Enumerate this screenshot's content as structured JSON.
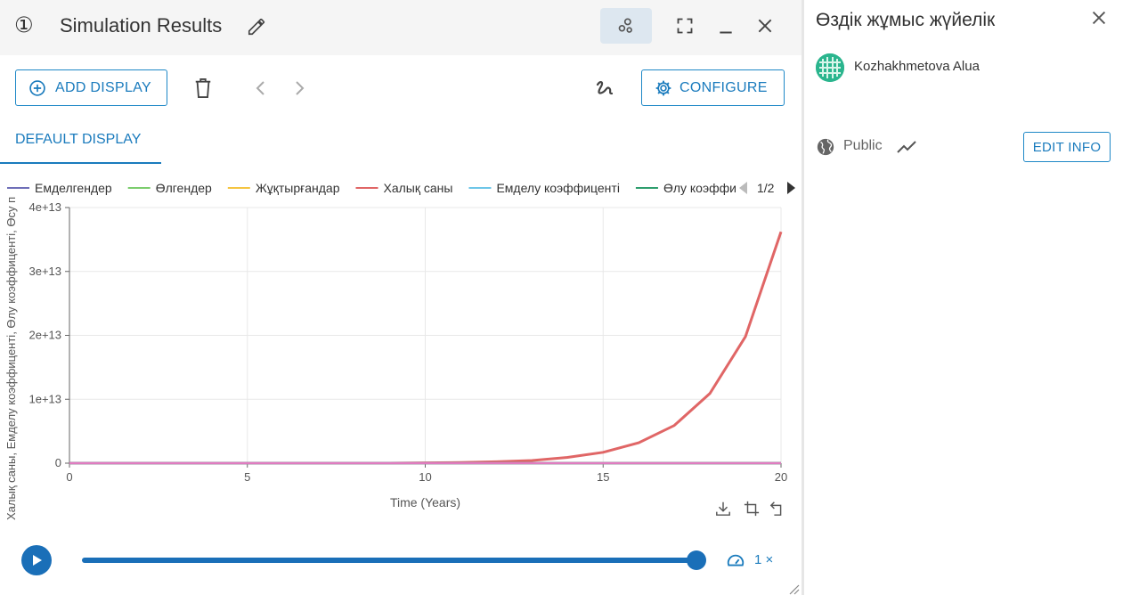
{
  "window": {
    "number": "①",
    "title": "Simulation Results"
  },
  "toolbar": {
    "add_display_label": "ADD DISPLAY",
    "configure_label": "CONFIGURE"
  },
  "tabs": [
    {
      "label": "DEFAULT DISPLAY",
      "active": true
    }
  ],
  "chart_data": {
    "type": "line",
    "xlabel": "Time (Years)",
    "ylabel": "Халық саны, Емделу коэффиценті, Өлу коэффиценті, Өсу п",
    "xlim": [
      0,
      20
    ],
    "ylim": [
      0,
      40000000000000
    ],
    "x_ticks": [
      0,
      5,
      10,
      15,
      20
    ],
    "x_tick_labels": [
      "0",
      "5",
      "10",
      "15",
      "20"
    ],
    "y_ticks": [
      0,
      10000000000000,
      20000000000000,
      30000000000000,
      40000000000000
    ],
    "y_tick_labels": [
      "0",
      "1e+13",
      "2e+13",
      "3e+13",
      "4e+13"
    ],
    "grid": true,
    "legend_position": "top",
    "legend_page": "1/2",
    "x": [
      0,
      1,
      2,
      3,
      4,
      5,
      6,
      7,
      8,
      9,
      10,
      11,
      12,
      13,
      14,
      15,
      16,
      17,
      18,
      19,
      20
    ],
    "series": [
      {
        "name": "Емделгендер",
        "color": "#6f6fb8",
        "values": [
          0,
          0,
          0,
          0,
          0,
          0,
          0,
          0,
          0,
          0,
          0,
          0,
          0,
          0,
          0,
          0,
          0,
          0,
          0,
          0,
          0
        ]
      },
      {
        "name": "Өлгендер",
        "color": "#7ccd6e",
        "values": [
          0,
          0,
          0,
          0,
          0,
          0,
          0,
          0,
          0,
          0,
          0,
          0,
          0,
          0,
          0,
          0,
          0,
          0,
          0,
          0,
          0
        ]
      },
      {
        "name": "Жұқтырғандар",
        "color": "#f5c542",
        "values": [
          0,
          0,
          0,
          0,
          0,
          0,
          0,
          0,
          0,
          0,
          0,
          0,
          0,
          0,
          0,
          0,
          0,
          0,
          0,
          0,
          0
        ]
      },
      {
        "name": "Халық саны",
        "color": "#e06666",
        "values": [
          0,
          0,
          0,
          0,
          0,
          0,
          0,
          0,
          0,
          0,
          50000000000,
          100000000000,
          220000000000,
          420000000000,
          900000000000,
          1700000000000,
          3200000000000,
          5900000000000,
          10900000000000,
          19800000000000,
          36200000000000
        ]
      },
      {
        "name": "Емделу коэффиценті",
        "color": "#6ec6e8",
        "values": [
          0,
          0,
          0,
          0,
          0,
          0,
          0,
          0,
          0,
          0,
          0,
          0,
          0,
          0,
          0,
          0,
          0,
          0,
          0,
          0,
          0
        ]
      },
      {
        "name": "Өлу коэффи",
        "color": "#2e9e6e",
        "values": [
          0,
          0,
          0,
          0,
          0,
          0,
          0,
          0,
          0,
          0,
          0,
          0,
          0,
          0,
          0,
          0,
          0,
          0,
          0,
          0,
          0
        ]
      },
      {
        "name": "",
        "color": "#e07cc0",
        "values": [
          0,
          0,
          0,
          0,
          0,
          0,
          0,
          0,
          0,
          0,
          0,
          0,
          0,
          0,
          0,
          0,
          0,
          0,
          0,
          0,
          0
        ]
      }
    ]
  },
  "playback": {
    "speed": "1 ×",
    "progress": 1.0
  },
  "info_panel": {
    "title": "Өздік жұмыс жүйелік",
    "author": "Kozhakhmetova Alua",
    "visibility": "Public",
    "edit_label": "EDIT INFO"
  },
  "colors": {
    "accent": "#1a7bbd",
    "playback": "#1a6fb8"
  }
}
